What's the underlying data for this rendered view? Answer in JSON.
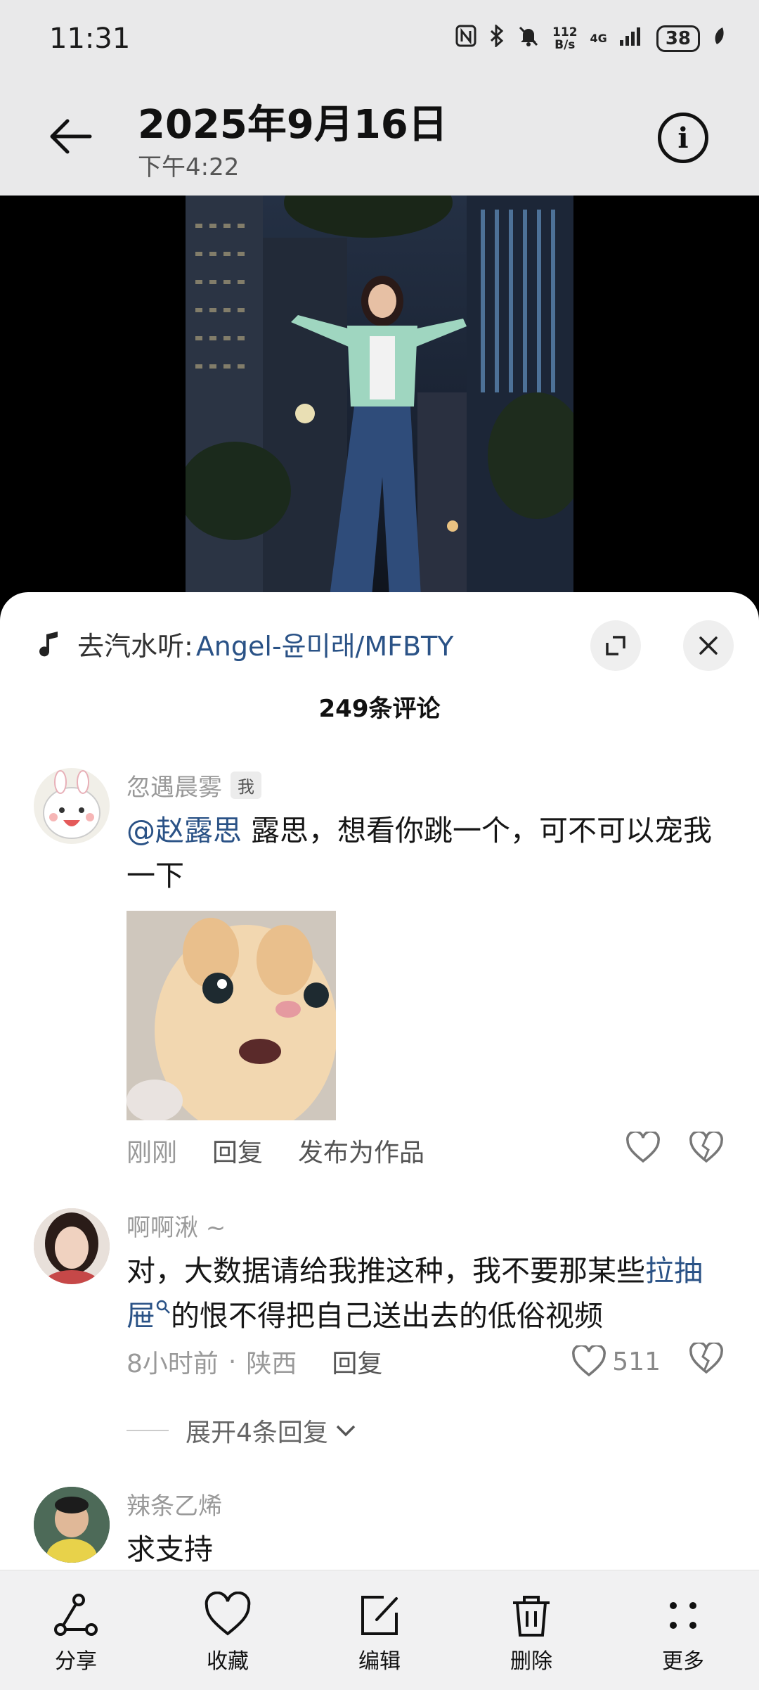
{
  "status_bar": {
    "time": "11:31",
    "net_speed_value": "112",
    "net_speed_unit": "B/s",
    "network": "4G",
    "battery": "38"
  },
  "header": {
    "date": "2025年9月16日",
    "time": "下午4:22"
  },
  "music": {
    "prefix": "去汽水听:",
    "track": "Angel-윤미래/MFBTY"
  },
  "comment_count": "249条评论",
  "comments": [
    {
      "user": "忽遇晨雾",
      "badge": "我",
      "mention": "@赵露思",
      "text": " 露思，想看你跳一个，可不可以宠我一下",
      "time": "刚刚",
      "reply": "回复",
      "publish": "发布为作品"
    },
    {
      "user": "啊啊湫 ~",
      "text_before": "对，大数据请给我推这种，我不要那某些",
      "link_word": "拉抽屉",
      "text_after": "的恨不得把自己送出去的低俗视频",
      "time": "8小时前",
      "location": "陕西",
      "reply": "回复",
      "likes": "511",
      "expand": "展开4条回复"
    },
    {
      "user": "辣条乙烯",
      "text": "求支持"
    }
  ],
  "toolbar": {
    "share": "分享",
    "favorite": "收藏",
    "edit": "编辑",
    "delete": "删除",
    "more": "更多"
  }
}
